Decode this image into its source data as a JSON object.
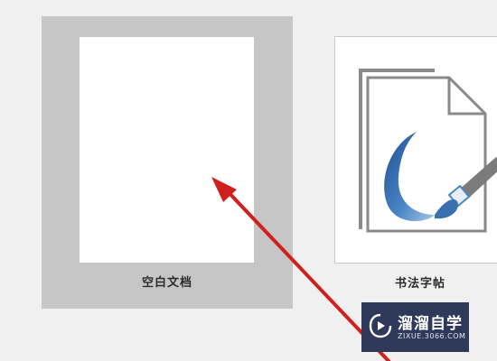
{
  "templates": [
    {
      "label": "空白文档",
      "selected": true
    },
    {
      "label": "书法字帖",
      "selected": false
    }
  ],
  "watermark": {
    "title": "溜溜自学",
    "url": "ZIXUE.3066.COM"
  },
  "colors": {
    "background": "#f0f0f0",
    "selected_tile": "#c6c6c6",
    "arrow": "#d0201e",
    "watermark_bg": "#2f3a5a",
    "calligraphy_blue": "#3a6fb0"
  }
}
